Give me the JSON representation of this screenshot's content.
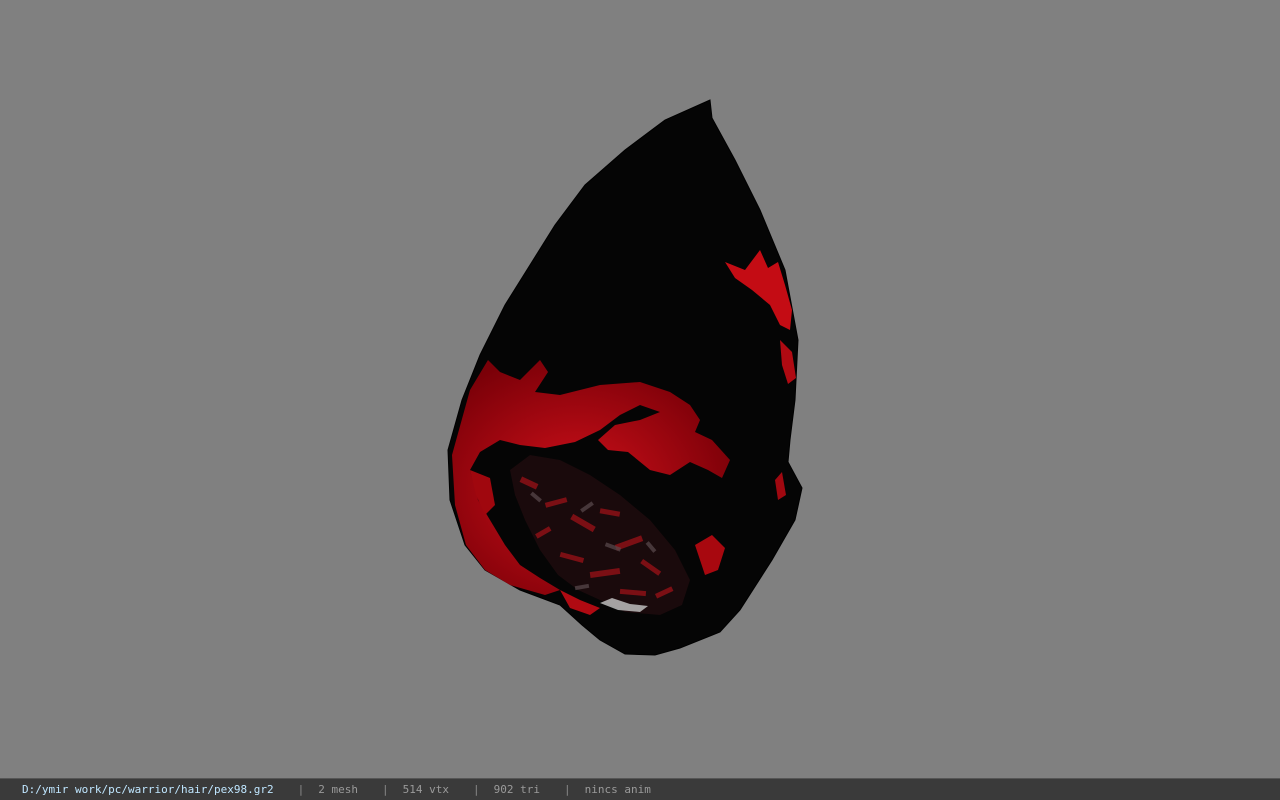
{
  "viewer": {
    "background_color": "#808080",
    "model_icon": "hooded-head-mesh"
  },
  "status": {
    "path": "D:/ymir work/pc/warrior/hair/pex98.gr2",
    "separator": "|",
    "mesh": "2 mesh",
    "vtx": "514 vtx",
    "tri": "902 tri",
    "anim": "nincs anim",
    "path_color": "#bfe6ff"
  }
}
